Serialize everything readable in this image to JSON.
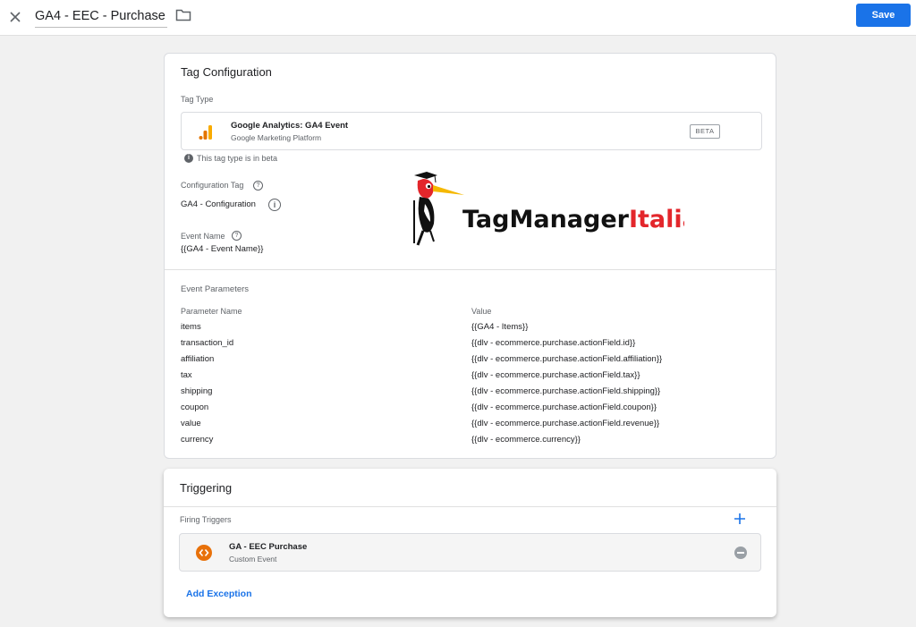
{
  "header": {
    "title": "GA4 - EEC - Purchase",
    "save_label": "Save",
    "close_icon": "close-icon",
    "folder_icon": "folder-icon"
  },
  "tag_config": {
    "title": "Tag Configuration",
    "tag_type_label": "Tag Type",
    "tag_type_name": "Google Analytics: GA4 Event",
    "tag_type_sub": "Google Marketing Platform",
    "beta_badge": "BETA",
    "beta_note": "This tag type is in beta",
    "config_tag_label": "Configuration Tag",
    "config_tag_value": "GA4 - Configuration",
    "event_name_label": "Event Name",
    "event_name_value": "{{GA4 - Event Name}}",
    "event_params_label": "Event Parameters",
    "col_param_name": "Parameter Name",
    "col_value": "Value",
    "params": [
      {
        "name": "items",
        "value": "{{GA4 - Items}}"
      },
      {
        "name": "transaction_id",
        "value": "{{dlv - ecommerce.purchase.actionField.id}}"
      },
      {
        "name": "affiliation",
        "value": "{{dlv - ecommerce.purchase.actionField.affiliation}}"
      },
      {
        "name": "tax",
        "value": "{{dlv - ecommerce.purchase.actionField.tax}}"
      },
      {
        "name": "shipping",
        "value": "{{dlv - ecommerce.purchase.actionField.shipping}}"
      },
      {
        "name": "coupon",
        "value": "{{dlv - ecommerce.purchase.actionField.coupon}}"
      },
      {
        "name": "value",
        "value": "{{dlv - ecommerce.purchase.actionField.revenue}}"
      },
      {
        "name": "currency",
        "value": "{{dlv - ecommerce.currency}}"
      }
    ]
  },
  "watermark": {
    "text_black": "TagManager",
    "text_red": "Italia"
  },
  "triggering": {
    "title": "Triggering",
    "firing_label": "Firing Triggers",
    "trigger_name": "GA - EEC Purchase",
    "trigger_type": "Custom Event",
    "add_exception": "Add Exception"
  },
  "colors": {
    "accent": "#1a73e8",
    "ga_orange": "#f9ab00",
    "custom_event_orange": "#e8710a",
    "brand_red": "#e3262b"
  }
}
